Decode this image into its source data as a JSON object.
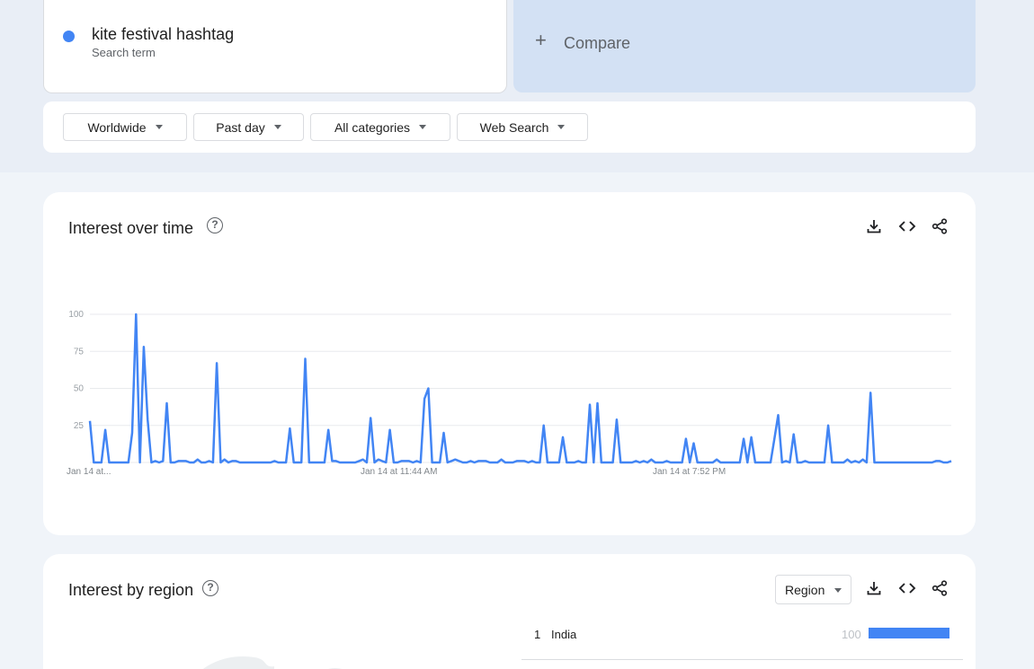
{
  "term": {
    "name": "kite festival hashtag",
    "sublabel": "Search term",
    "color": "#4285f4"
  },
  "compare": {
    "icon": "plus-icon",
    "label": "Compare"
  },
  "filters": [
    {
      "label": "Worldwide"
    },
    {
      "label": "Past day"
    },
    {
      "label": "All categories"
    },
    {
      "label": "Web Search"
    }
  ],
  "interest_over_time": {
    "title": "Interest over time",
    "icons": [
      "help-icon",
      "download-icon",
      "embed-icon",
      "share-icon"
    ]
  },
  "interest_by_region": {
    "title": "Interest by region",
    "dropdown": "Region",
    "rows": [
      {
        "rank": "1",
        "name": "India",
        "value": "100",
        "fraction": 1.0
      }
    ]
  },
  "chart_data": {
    "type": "line",
    "series": [
      {
        "color": "#4285f4",
        "values": [
          28,
          0,
          0,
          0,
          22,
          0,
          0,
          0,
          0,
          0,
          0,
          20,
          100,
          0,
          78,
          29,
          0,
          1,
          0,
          1,
          40,
          0,
          0,
          1,
          1,
          1,
          0,
          0,
          2,
          0,
          0,
          1,
          0,
          67,
          0,
          2,
          0,
          1,
          1,
          0,
          0,
          0,
          0,
          0,
          0,
          0,
          0,
          0,
          1,
          0,
          0,
          0,
          23,
          0,
          0,
          0,
          70,
          0,
          0,
          0,
          0,
          0,
          22,
          1,
          1,
          0,
          0,
          0,
          0,
          0,
          1,
          2,
          0,
          30,
          0,
          2,
          1,
          0,
          22,
          0,
          0,
          1,
          1,
          1,
          0,
          1,
          0,
          43,
          50,
          0,
          0,
          0,
          20,
          0,
          1,
          2,
          1,
          0,
          0,
          1,
          0,
          1,
          1,
          1,
          0,
          0,
          0,
          2,
          0,
          0,
          0,
          1,
          1,
          1,
          0,
          1,
          0,
          0,
          25,
          0,
          0,
          0,
          0,
          17,
          0,
          0,
          0,
          1,
          0,
          0,
          39,
          0,
          40,
          0,
          0,
          0,
          0,
          29,
          0,
          0,
          0,
          0,
          1,
          0,
          1,
          0,
          2,
          0,
          0,
          0,
          1,
          0,
          0,
          0,
          0,
          16,
          0,
          13,
          0,
          0,
          0,
          0,
          0,
          2,
          0,
          0,
          0,
          0,
          0,
          0,
          16,
          0,
          17,
          0,
          0,
          0,
          0,
          0,
          16,
          32,
          0,
          1,
          0,
          19,
          0,
          0,
          1,
          0,
          0,
          0,
          0,
          0,
          25,
          0,
          0,
          0,
          0,
          2,
          0,
          1,
          0,
          2,
          0,
          47,
          0,
          0,
          0,
          0,
          0,
          0,
          0,
          0,
          0,
          0,
          0,
          0,
          0,
          0,
          0,
          0,
          1,
          1,
          0,
          0,
          1
        ]
      }
    ],
    "x_tick_labels": [
      "Jan 14 at...",
      "Jan 14 at 11:44 AM",
      "Jan 14 at 7:52 PM"
    ],
    "y_ticks": [
      "100",
      "75",
      "50",
      "25"
    ],
    "ylim": [
      0,
      100
    ],
    "grid": true
  }
}
